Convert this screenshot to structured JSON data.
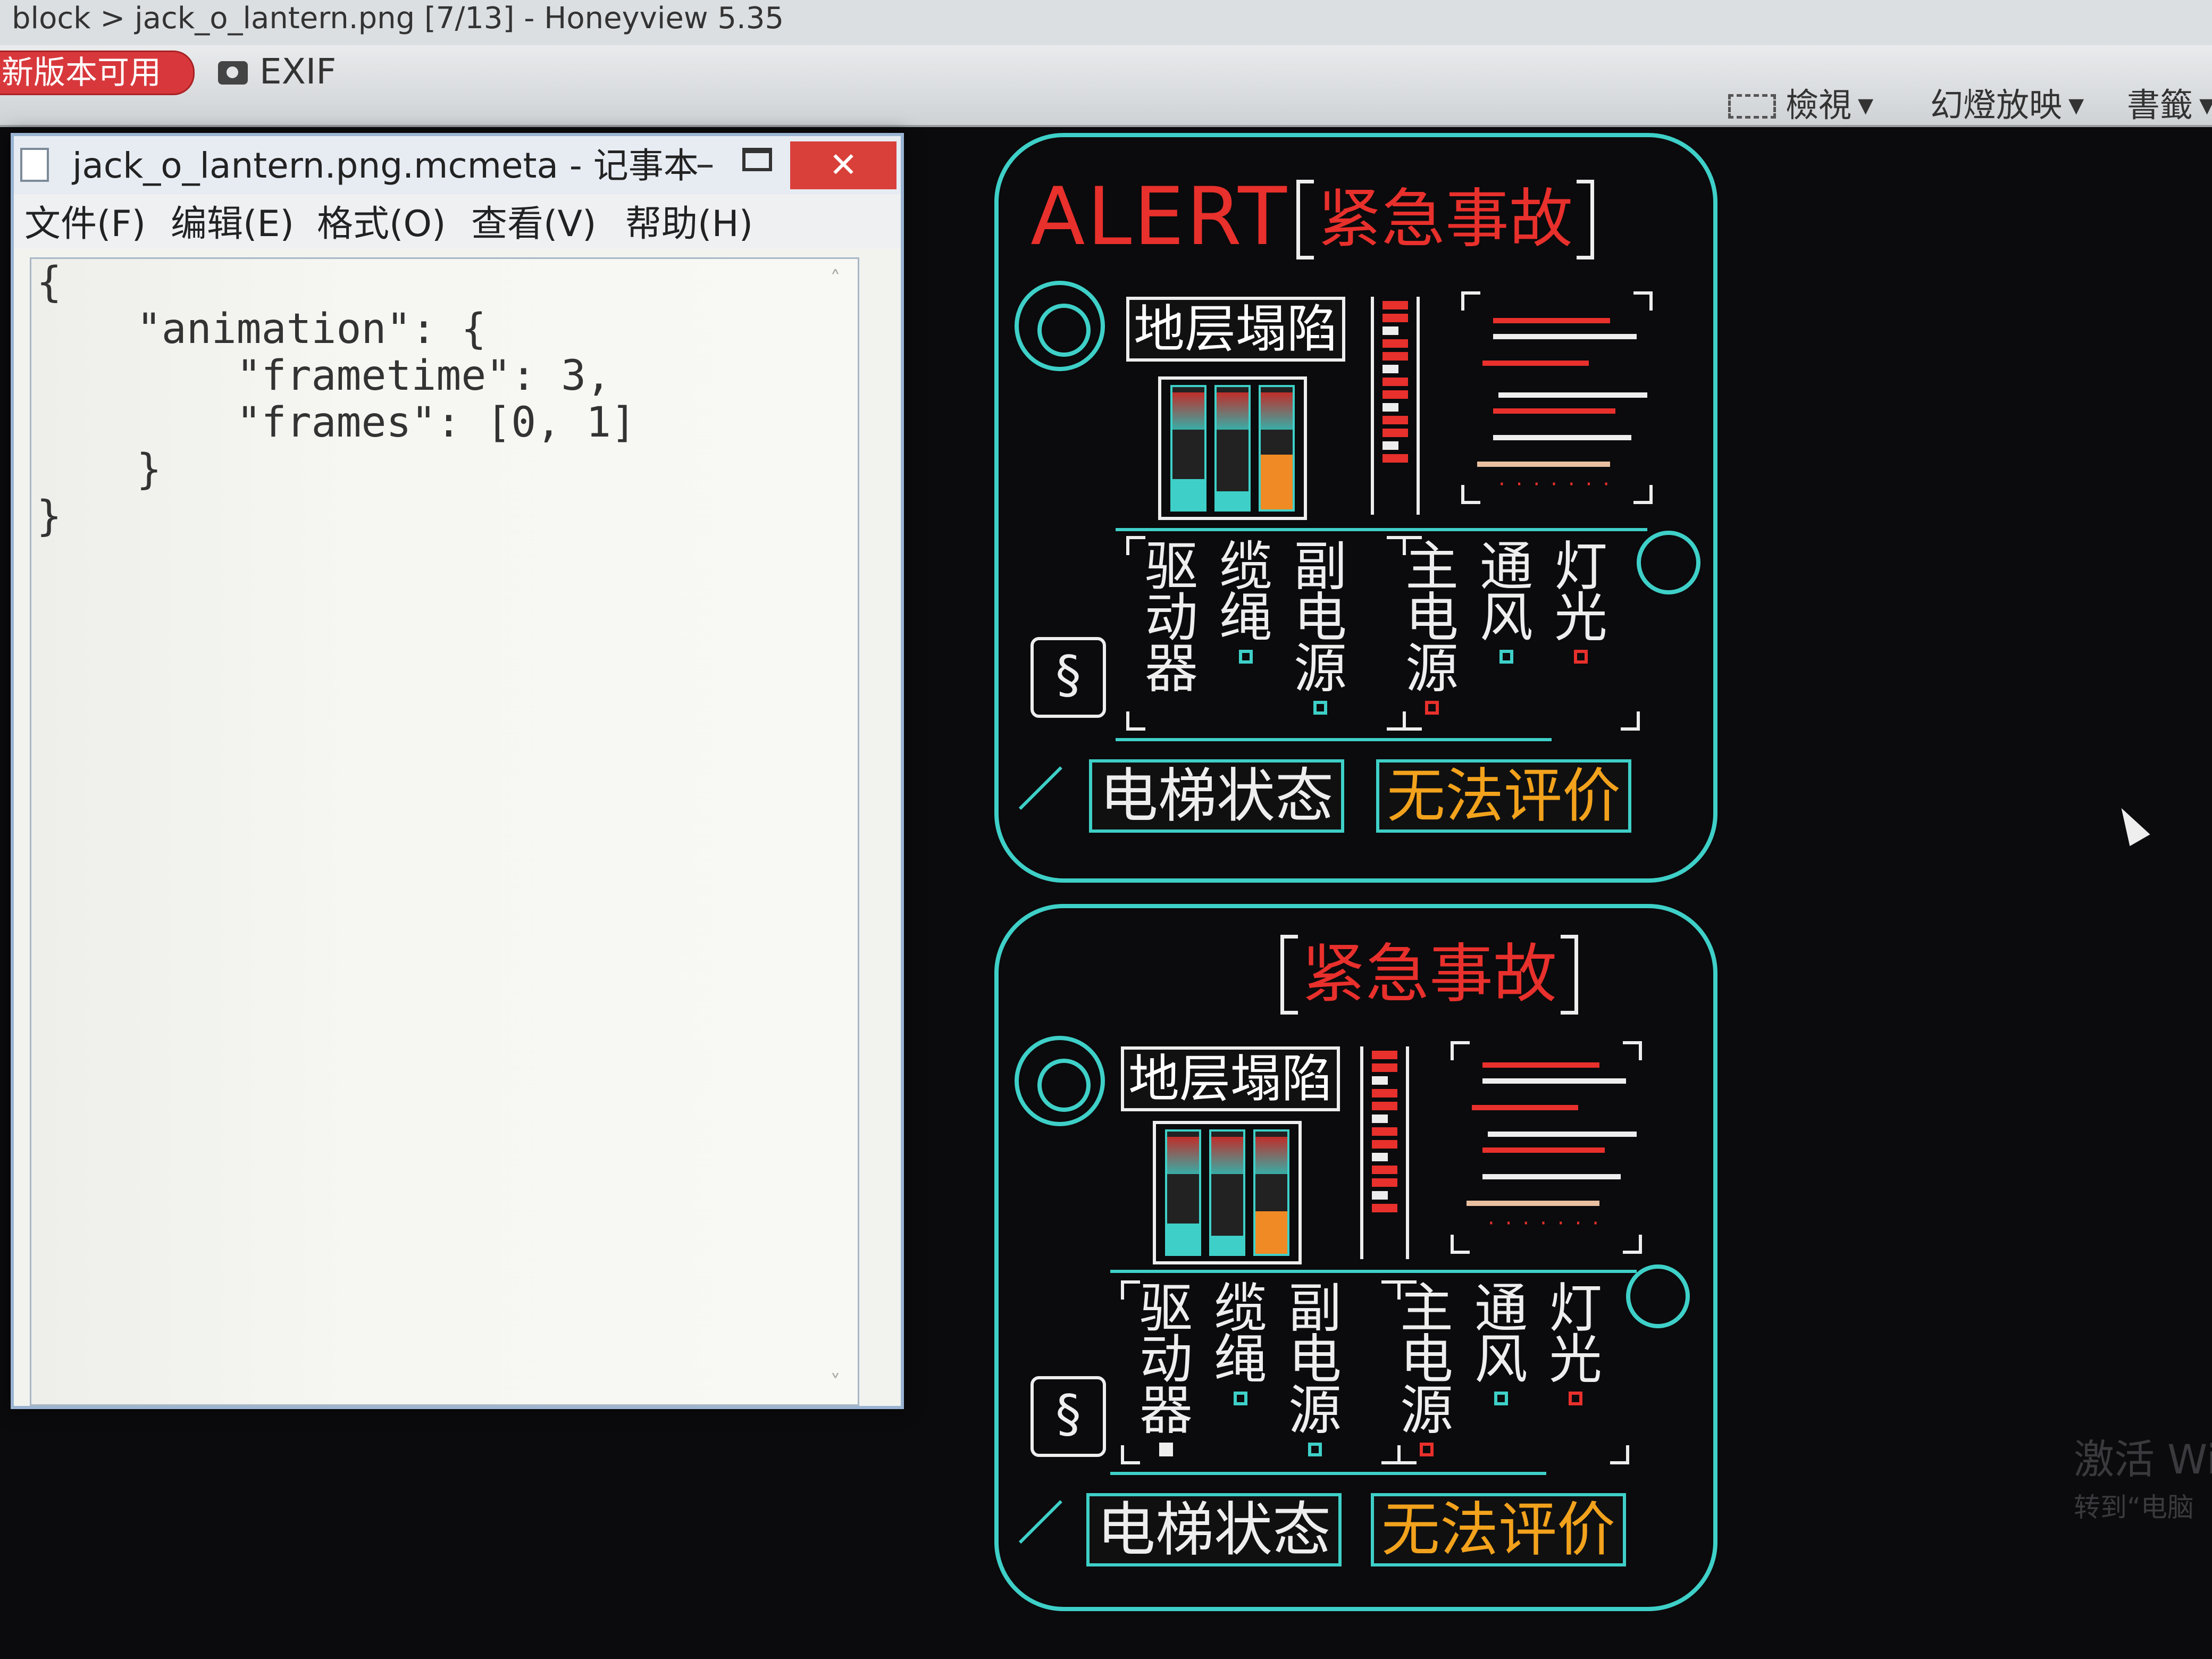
{
  "honeyview": {
    "title": "block > jack_o_lantern.png [7/13] - Honeyview 5.35",
    "update_badge": "新版本可用",
    "exif_label": "EXIF",
    "view_label": "檢視",
    "slideshow_label": "幻燈放映",
    "bookmark_label": "書籤"
  },
  "notepad": {
    "title": "jack_o_lantern.png.mcmeta - 记事本",
    "menus": [
      "文件(F)",
      "编辑(E)",
      "格式(O)",
      "查看(V)",
      "帮助(H)"
    ],
    "content": "{\n    \"animation\": {\n        \"frametime\": 3,\n        \"frames\": [0, 1]\n    }\n}"
  },
  "panels": [
    {
      "alert_text": "ALERT",
      "emergency_title": "紧急事故",
      "collapse_label": "地层塌陷",
      "status_label": "电梯状态",
      "status_value": "无法评价",
      "vertical_labels": [
        {
          "text": "驱动器",
          "indicator": "none"
        },
        {
          "text": "缆绳",
          "indicator": "cyan"
        },
        {
          "text": "副电源",
          "indicator": "cyan"
        },
        {
          "text": "主电源",
          "indicator": "red"
        },
        {
          "text": "通风",
          "indicator": "cyan"
        },
        {
          "text": "灯光",
          "indicator": "red"
        }
      ]
    },
    {
      "alert_text": "",
      "emergency_title": "紧急事故",
      "collapse_label": "地层塌陷",
      "status_label": "电梯状态",
      "status_value": "无法评价",
      "vertical_labels": [
        {
          "text": "驱动器",
          "indicator": "white"
        },
        {
          "text": "缆绳",
          "indicator": "cyan"
        },
        {
          "text": "副电源",
          "indicator": "cyan"
        },
        {
          "text": "主电源",
          "indicator": "red"
        },
        {
          "text": "通风",
          "indicator": "cyan"
        },
        {
          "text": "灯光",
          "indicator": "red"
        }
      ]
    }
  ],
  "gauges": [
    [
      0.25,
      0.15,
      0.45
    ],
    [
      0.25,
      0.15,
      0.35
    ]
  ],
  "watermark": {
    "line1": "激活 Wi",
    "line2": "转到“电脑"
  },
  "colors": {
    "cyan": "#3ed0c8",
    "red": "#e8302c",
    "amber": "#f2a21c"
  }
}
